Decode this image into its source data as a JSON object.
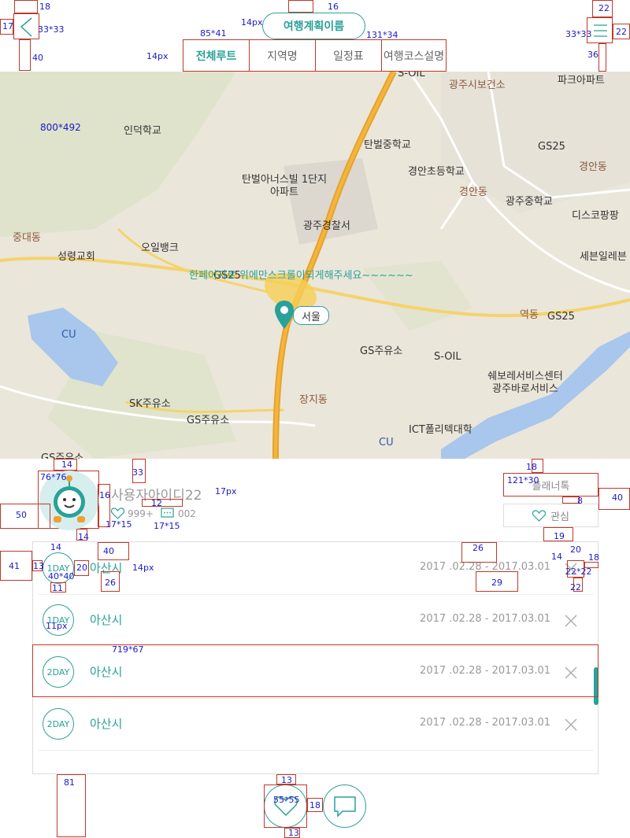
{
  "header": {
    "title": "여행계획이름",
    "tabs": [
      "전체루트",
      "지역명",
      "일정표",
      "여행코스설명"
    ]
  },
  "map": {
    "overlay_text": "한페이지로 위에만스크롤이되게해주세요~~~~~~",
    "marker_label": "서울",
    "labels": [
      "S-OIL",
      "광주시보건소",
      "파크아파트",
      "인덕학교",
      "탄벌중학교",
      "GS25",
      "경안동",
      "경안초등학교",
      "탄벌아너스빌 1단지아파트",
      "경안동",
      "광주중학교",
      "디스코팡팡",
      "광주경찰서",
      "중대동",
      "성령교회",
      "오일뱅크",
      "GS25",
      "세븐일레븐",
      "CU",
      "역동",
      "GS25",
      "GS주유소",
      "S-OIL",
      "쉐보레서비스센터 광주바로서비스",
      "장지동",
      "SK주유소",
      "GS주유소",
      "ICT폴리텍대학",
      "CU",
      "GS주유소"
    ]
  },
  "profile": {
    "username": "사용자아이디22",
    "likes": "999+",
    "messages": "002",
    "planner_button": "플래너톡",
    "like_button": "관심"
  },
  "itinerary": [
    {
      "day": "1DAY",
      "place": "아산시",
      "dates": "2017 .02.28 - 2017.03.01"
    },
    {
      "day": "1DAY",
      "place": "아산시",
      "dates": "2017 .02.28 - 2017.03.01"
    },
    {
      "day": "2DAY",
      "place": "아산시",
      "dates": "2017 .02.28 - 2017.03.01"
    },
    {
      "day": "2DAY",
      "place": "아산시",
      "dates": "2017 .02.28 - 2017.03.01"
    }
  ],
  "annotations": [
    "18",
    "16",
    "14px",
    "22",
    "17",
    "33*33",
    "33*33",
    "22",
    "85*41",
    "131*34",
    "14px",
    "40",
    "36",
    "800*492",
    "14",
    "76*76",
    "33",
    "16",
    "17px",
    "18",
    "121*30",
    "50",
    "12",
    "40",
    "17*15",
    "999+",
    "17*15",
    "14",
    "8",
    "14",
    "19",
    "41",
    "40",
    "26",
    "20",
    "13",
    "1DAY",
    "40*40",
    "20",
    "26",
    "14px",
    "14",
    "18",
    "11",
    "29",
    "22*22",
    "22",
    "11px",
    "719*67",
    "81",
    "13",
    "55*55",
    "18",
    "13"
  ],
  "colors": {
    "accent": "#2aa198",
    "annotation": "#1a1ac8",
    "guide": "#c0392b"
  }
}
